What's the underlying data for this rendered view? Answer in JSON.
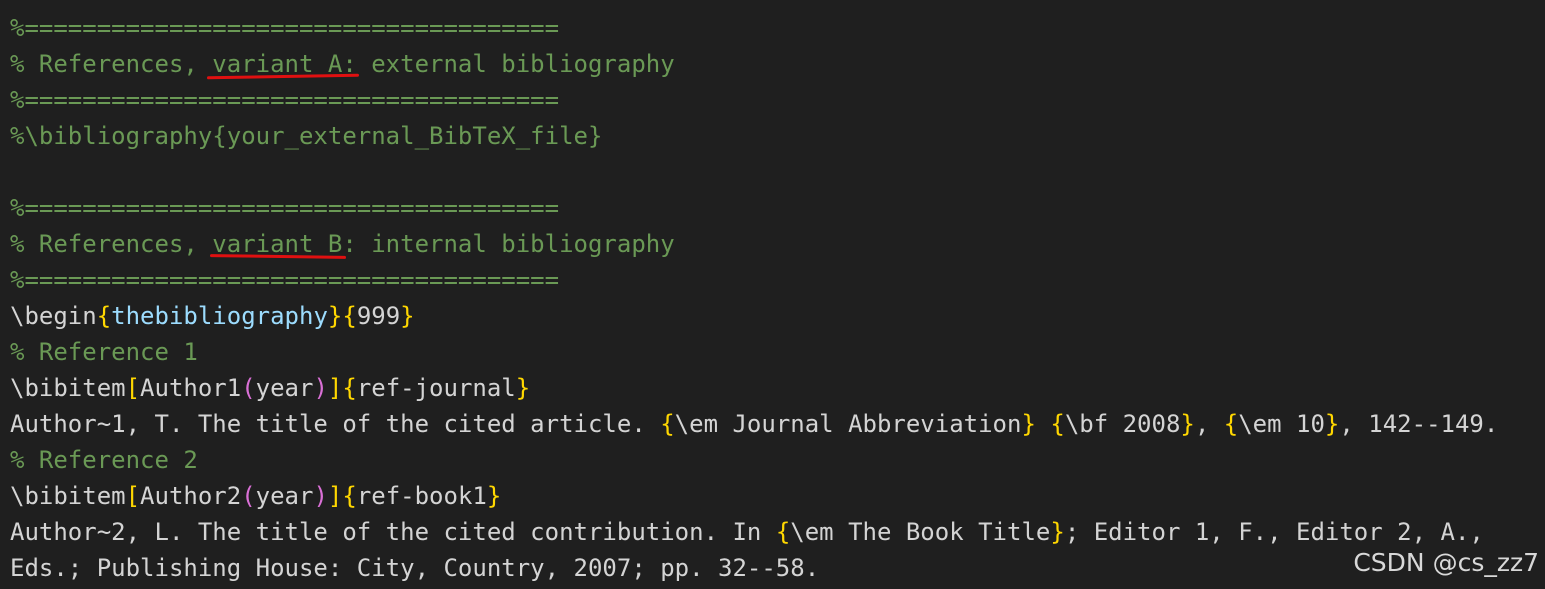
{
  "lines": {
    "l1": "%=====================================",
    "l2": "% References, variant A: external bibliography",
    "l3": "%=====================================",
    "l4": "%\\bibliography{your_external_BibTeX_file}",
    "l6": "%=====================================",
    "l7": "% References, variant B: internal bibliography",
    "l8": "%=====================================",
    "l9": {
      "cmd": "\\begin",
      "open": "{",
      "env": "thebibliography",
      "close": "}",
      "arg_open": "{",
      "arg": "999",
      "arg_close": "}"
    },
    "l10": "% Reference 1",
    "l11": {
      "cmd": "\\bibitem",
      "sq_open": "[",
      "name": "Author1",
      "p_open": "(",
      "year": "year",
      "p_close": ")",
      "sq_close": "]",
      "key_open": "{",
      "key": "ref-journal",
      "key_close": "}"
    },
    "l12": {
      "t1": "Author~1, T. The title of the cited article. ",
      "b1o": "{",
      "e1": "\\em Journal Abbreviation",
      "b1c": "}",
      "sp1": " ",
      "b2o": "{",
      "e2": "\\bf 2008",
      "b2c": "}",
      "t2": ", ",
      "b3o": "{",
      "e3": "\\em 10",
      "b3c": "}",
      "t3": ", 142--149."
    },
    "l13": "% Reference 2",
    "l14": {
      "cmd": "\\bibitem",
      "sq_open": "[",
      "name": "Author2",
      "p_open": "(",
      "year": "year",
      "p_close": ")",
      "sq_close": "]",
      "key_open": "{",
      "key": "ref-book1",
      "key_close": "}"
    },
    "l15": {
      "t1": "Author~2, L. The title of the cited contribution. In ",
      "bo": "{",
      "e": "\\em The Book Title",
      "bc": "}",
      "t2": "; Editor 1, F., Editor 2, A.,"
    },
    "l16": "Eds.; Publishing House: City, Country, 2007; pp. 32--58."
  },
  "watermark": "CSDN @cs_zz7",
  "colors": {
    "background": "#1f1f1f",
    "comment": "#6a9955",
    "bracket_level1": "#ffd700",
    "bracket_level2": "#da70d6",
    "environment": "#9cdcfe",
    "annotation_underline": "#e01010"
  }
}
